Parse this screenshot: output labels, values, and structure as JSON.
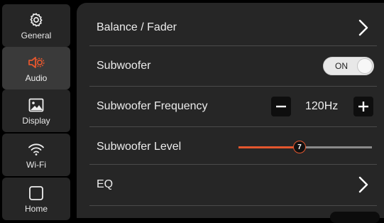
{
  "sidebar": {
    "items": [
      {
        "label": "General",
        "icon": "gear-icon"
      },
      {
        "label": "Audio",
        "icon": "speaker-icon",
        "active": true
      },
      {
        "label": "Display",
        "icon": "image-icon"
      },
      {
        "label": "Wi-Fi",
        "icon": "wifi-icon"
      },
      {
        "label": "Home",
        "icon": "home-square-icon"
      }
    ]
  },
  "settings": {
    "balance_fader": {
      "label": "Balance / Fader"
    },
    "subwoofer": {
      "label": "Subwoofer",
      "toggle_text": "ON"
    },
    "subwoofer_frequency": {
      "label": "Subwoofer Frequency",
      "value": "120Hz"
    },
    "subwoofer_level": {
      "label": "Subwoofer Level",
      "value": "7",
      "level_fraction": 0.46
    },
    "eq": {
      "label": "EQ"
    }
  },
  "colors": {
    "accent": "#e4572e",
    "panel": "#262626",
    "background": "#000000"
  }
}
